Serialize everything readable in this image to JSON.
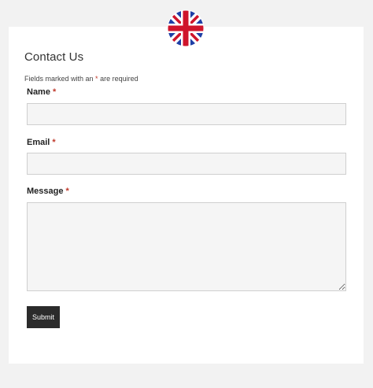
{
  "language": {
    "icon": "uk-flag-icon",
    "colors": {
      "blue": "#1f3fa6",
      "red": "#cf142b",
      "white": "#ffffff"
    }
  },
  "form": {
    "title": "Contact Us",
    "required_note_prefix": "Fields marked with an ",
    "required_marker": "*",
    "required_note_suffix": " are required",
    "fields": {
      "name": {
        "label": "Name",
        "value": "",
        "placeholder": ""
      },
      "email": {
        "label": "Email",
        "value": "",
        "placeholder": ""
      },
      "message": {
        "label": "Message",
        "value": "",
        "placeholder": ""
      }
    },
    "submit_label": "Submit"
  },
  "colors": {
    "background": "#f2f2f2",
    "card": "#ffffff",
    "field_bg": "#f5f5f5",
    "required": "#c0392b",
    "button": "#2b2b2b"
  }
}
